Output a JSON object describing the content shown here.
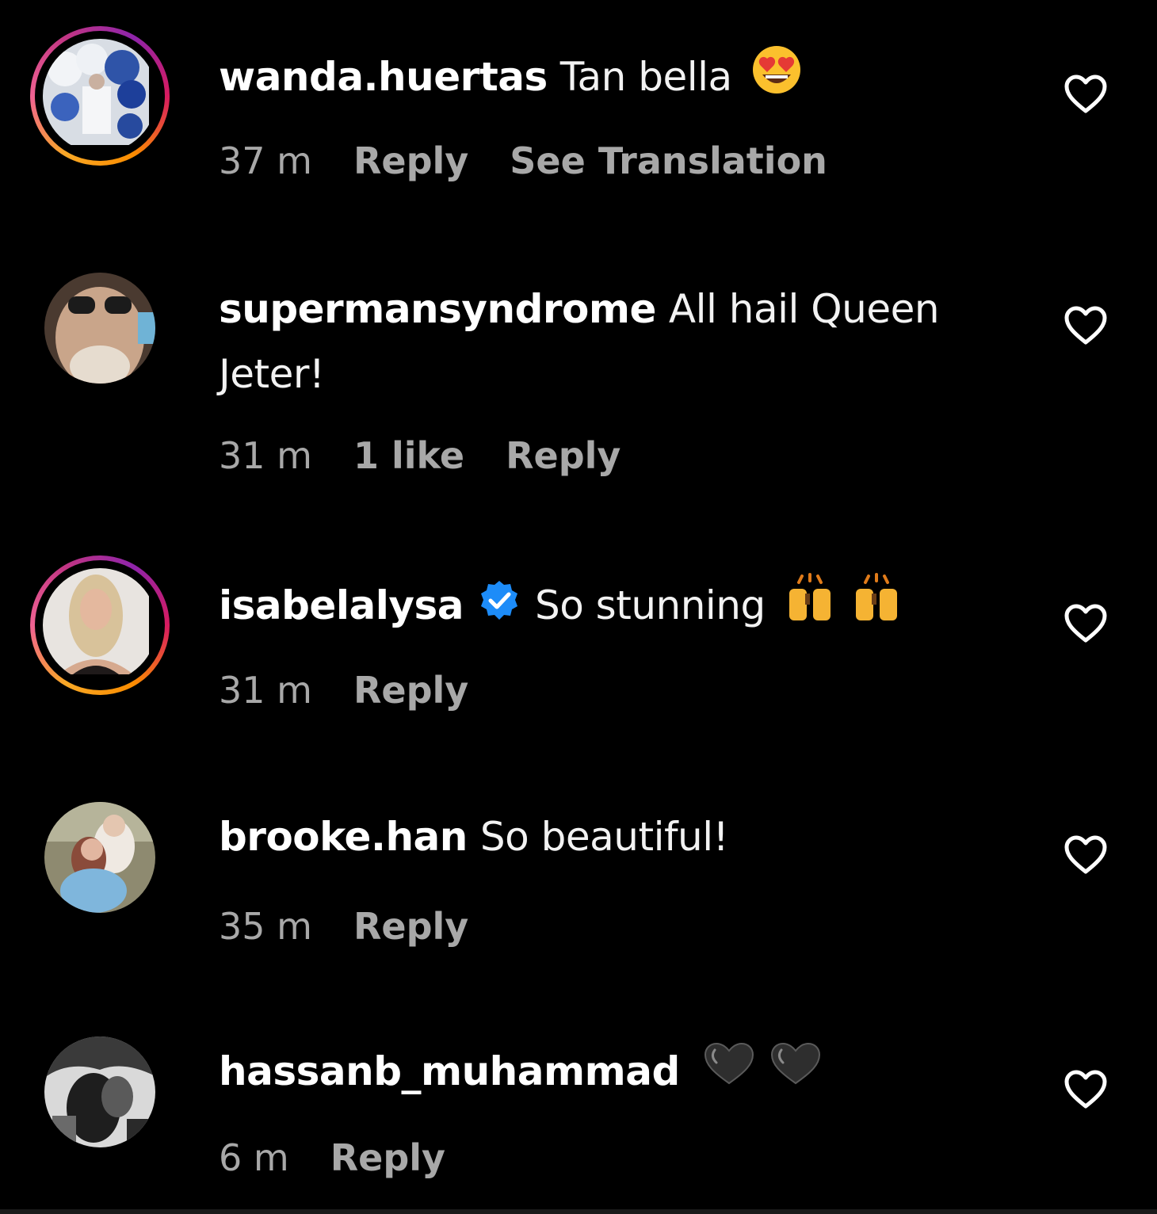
{
  "comments": [
    {
      "username": "wanda.huertas",
      "text": "Tan bella",
      "emoji": "heart-eyes-emoji",
      "time": "37 m",
      "likes": "",
      "reply": "Reply",
      "extra": "See Translation",
      "has_story_ring": true
    },
    {
      "username": "supermansyndrome",
      "text_line1": "All hail Queen",
      "text_line2": "Jeter!",
      "time": "31 m",
      "likes": "1 like",
      "reply": "Reply",
      "has_story_ring": false
    },
    {
      "username": "isabelalysa",
      "verified": true,
      "text": "So stunning",
      "emoji": "raising-hands-emoji",
      "time": "31 m",
      "reply": "Reply",
      "has_story_ring": true
    },
    {
      "username": "brooke.han",
      "text": "So beautiful!",
      "time": "35 m",
      "reply": "Reply",
      "has_story_ring": false
    },
    {
      "username": "hassanb_muhammad",
      "text": "",
      "emoji": "black-heart-emoji",
      "time": "6 m",
      "reply": "Reply",
      "has_story_ring": false
    }
  ],
  "colors": {
    "background": "#000000",
    "meta_text": "#a8a8a8",
    "verified_badge": "#1d8cf8"
  }
}
